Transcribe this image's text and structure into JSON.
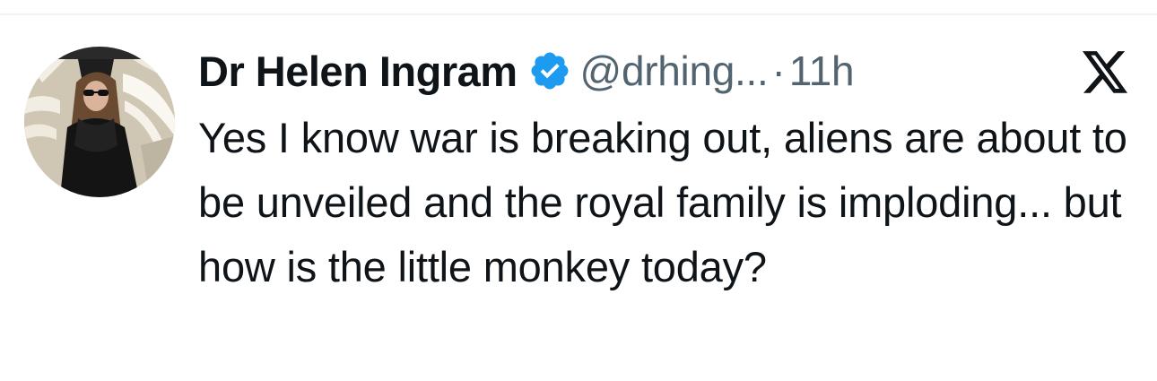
{
  "tweet": {
    "author": {
      "display_name": "Dr Helen Ingram",
      "handle": "@drhing...",
      "verified": true
    },
    "separator": "·",
    "time_ago": "11h",
    "text": "Yes I know war is breaking out, aliens are about to be unveiled and the royal family is imploding... but how is the little monkey today?"
  },
  "icons": {
    "verified": "verified-badge-icon",
    "platform": "x-logo-icon"
  },
  "colors": {
    "verified_blue": "#1d9bf0",
    "text_primary": "#0f1419",
    "text_secondary": "#536471",
    "divider": "#eff3f4"
  }
}
